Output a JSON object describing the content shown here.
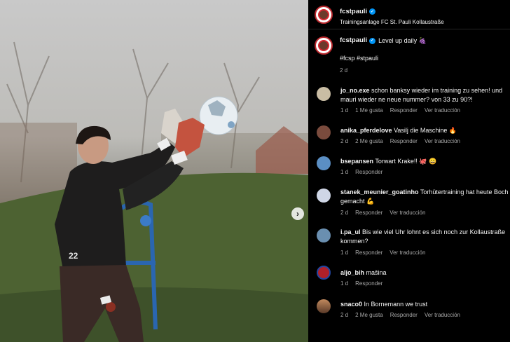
{
  "post": {
    "author": "fcstpauli",
    "location": "Trainingsanlage FC St. Pauli Kollaustraße",
    "caption": "Level up daily 🍇",
    "hashtags": "#fcsp #stpauli",
    "time": "2 d",
    "jersey_number": "22"
  },
  "comments": [
    {
      "user": "jo_no.exe",
      "text": "schon banksy wieder im training zu sehen! und",
      "text2": "mauri wieder ne neue nummer? von 33 zu 90?!",
      "time": "1 d",
      "likes": "1 Me gusta",
      "reply": "Responder",
      "translate": "Ver traducción",
      "avatar_color": "#c9bda4"
    },
    {
      "user": "anika_pferdelove",
      "text": "Vasilj die Maschine 🔥",
      "text2": "",
      "time": "2 d",
      "likes": "2 Me gusta",
      "reply": "Responder",
      "translate": "Ver traducción",
      "avatar_color": "#7a4b3d"
    },
    {
      "user": "bsepansen",
      "text": "Torwart Krake!! 🐙 😀",
      "text2": "",
      "time": "1 d",
      "likes": "",
      "reply": "Responder",
      "translate": "",
      "avatar_color": "#5b8fc4"
    },
    {
      "user": "stanek_meunier_goatinho",
      "text": "Torhütertraining hat heute Boch",
      "text2": "gemacht 💪",
      "time": "2 d",
      "likes": "",
      "reply": "Responder",
      "translate": "Ver traducción",
      "avatar_color": "#cfd6e6"
    },
    {
      "user": "i.pa_ul",
      "text": "Bis wie viel Uhr lohnt es sich noch zur Kollaustraße",
      "text2": "kommen?",
      "time": "1 d",
      "likes": "",
      "reply": "Responder",
      "translate": "Ver traducción",
      "avatar_color": "#6a8fb0"
    },
    {
      "user": "aljo_bih",
      "text": "mašina",
      "text2": "",
      "time": "1 d",
      "likes": "",
      "reply": "Responder",
      "translate": "",
      "avatar_color": "#b0202a"
    },
    {
      "user": "snaco0",
      "text": "In Bornemann we trust",
      "text2": "",
      "time": "2 d",
      "likes": "2 Me gusta",
      "reply": "Responder",
      "translate": "Ver traducción",
      "avatar_color": "#8a5a3c"
    }
  ],
  "icons": {
    "next": "chevron-right-icon",
    "verified": "verified-badge-icon"
  },
  "colors": {
    "verified": "#0095f6",
    "secondary_text": "#a8a8a8",
    "club_red": "#d8262f"
  }
}
